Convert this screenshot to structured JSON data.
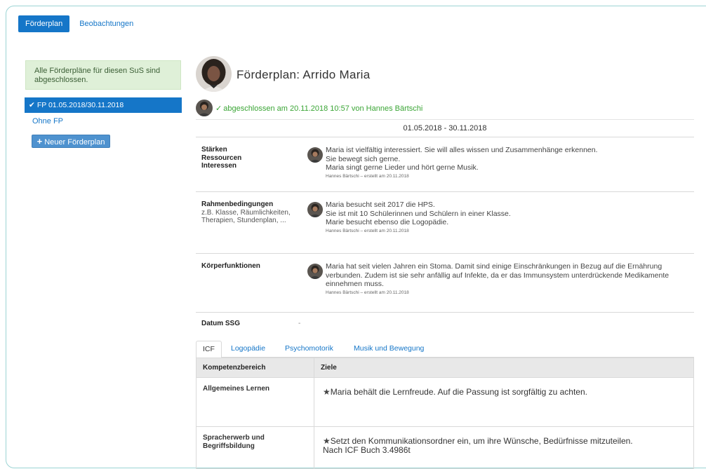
{
  "tabs": {
    "active": "Förderplan",
    "other": "Beobachtungen"
  },
  "sidebar": {
    "notice": "Alle Förderpläne für diesen SuS sind abgeschlossen.",
    "fp_item": "FP 01.05.2018/30.11.2018",
    "ohne_fp": "Ohne FP",
    "new_button": "Neuer Förderplan"
  },
  "header": {
    "title": "Förderplan: Arrido Maria",
    "status": "abgeschlossen am 20.11.2018 10:57 von Hannes Bärtschi",
    "date_range": "01.05.2018 - 30.11.2018"
  },
  "sections": [
    {
      "label_lines": [
        "Stärken",
        "Ressourcen",
        "Interessen"
      ],
      "text_lines": [
        "Maria ist vielfältig interessiert. Sie will alles wissen und Zusammenhänge erkennen.",
        "Sie bewegt sich gerne.",
        "Maria singt gerne Lieder und hört gerne Musik."
      ],
      "meta": "Hannes Bärtschi – erstellt am 20.11.2018"
    },
    {
      "label_title": "Rahmenbedingungen",
      "label_sub": "z.B. Klasse, Räumlichkeiten, Therapien, Stundenplan, ...",
      "text_lines": [
        "Maria besucht seit 2017 die HPS.",
        "Sie ist mit 10 Schülerinnen und Schülern in einer Klasse.",
        "Marie besucht ebenso die Logopädie."
      ],
      "meta": "Hannes Bärtschi – erstellt am 20.11.2018"
    },
    {
      "label_title": "Körperfunktionen",
      "text_lines": [
        "Maria hat seit vielen Jahren ein Stoma. Damit sind einige Einschränkungen in Bezug auf die Ernährung verbunden. Zudem ist sie sehr anfällig auf Infekte, da er das Immunsystem unterdrückende Medikamente einnehmen muss."
      ],
      "meta": "Hannes Bärtschi – erstellt am 20.11.2018"
    }
  ],
  "datum": {
    "label": "Datum SSG",
    "value": "-"
  },
  "sub_tabs": [
    "ICF",
    "Logopädie",
    "Psychomotorik",
    "Musik und Bewegung"
  ],
  "table": {
    "headers": [
      "Kompetenzbereich",
      "Ziele"
    ],
    "rows": [
      {
        "bereich": "Allgemeines Lernen",
        "ziel_lines": [
          "Maria behält die Lernfreude. Auf die Passung ist sorgfältig zu achten."
        ]
      },
      {
        "bereich": "Spracherwerb und Begriffsbildung",
        "ziel_lines": [
          "Setzt den Kommunikationsordner ein, um ihre Wünsche, Bedürfnisse mitzuteilen.",
          "Nach ICF Buch 3.4986t"
        ]
      }
    ]
  },
  "colors": {
    "primary": "#1576c8",
    "success": "#3aa535",
    "notice_bg": "#dff0d8"
  }
}
